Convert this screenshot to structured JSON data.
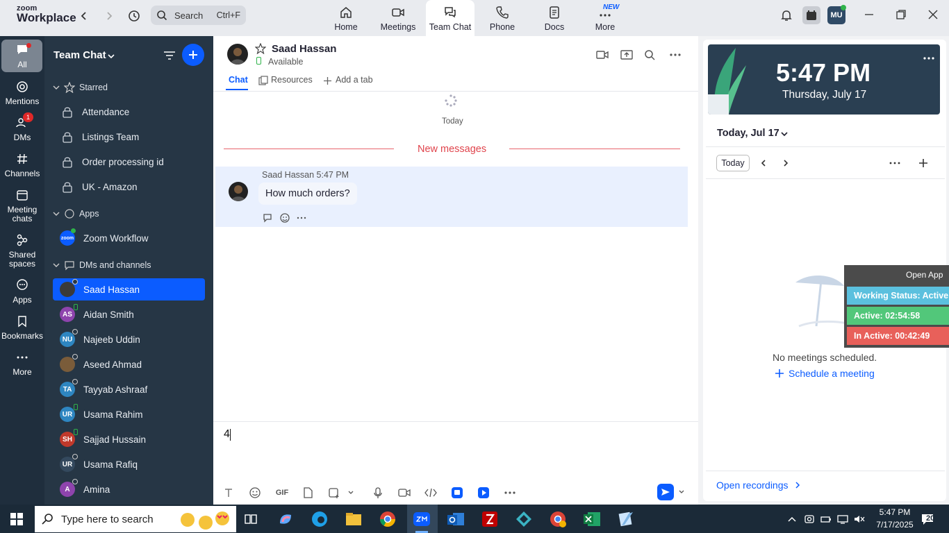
{
  "app": {
    "brand_top": "zoom",
    "brand_bottom": "Workplace"
  },
  "search": {
    "label": "Search",
    "shortcut": "Ctrl+F"
  },
  "nav_tabs": [
    {
      "label": "Home"
    },
    {
      "label": "Meetings"
    },
    {
      "label": "Team Chat",
      "active": true
    },
    {
      "label": "Phone"
    },
    {
      "label": "Docs"
    },
    {
      "label": "More",
      "badge": "NEW"
    }
  ],
  "user_avatar": "MU",
  "rail": [
    {
      "label": "All",
      "active": true
    },
    {
      "label": "Mentions"
    },
    {
      "label": "DMs",
      "badge": "1"
    },
    {
      "label": "Channels"
    },
    {
      "label": "Meeting chats"
    },
    {
      "label": "Shared spaces"
    },
    {
      "label": "Apps"
    },
    {
      "label": "Bookmarks"
    },
    {
      "label": "More"
    }
  ],
  "sidebar": {
    "title": "Team Chat",
    "sections": {
      "starred": "Starred",
      "apps": "Apps",
      "dms": "DMs and channels"
    },
    "starred_items": [
      "Attendance",
      "Listings Team",
      "Order processing id",
      "UK - Amazon"
    ],
    "app_items": [
      {
        "name": "Zoom Workflow",
        "icon_text": "zoom"
      }
    ],
    "dm_items": [
      {
        "name": "Saad Hassan",
        "initials": "",
        "color": "#3a3a3a",
        "selected": true
      },
      {
        "name": "Aidan Smith",
        "initials": "AS",
        "color": "#8e44ad",
        "online": true
      },
      {
        "name": "Najeeb Uddin",
        "initials": "NU",
        "color": "#2e86c1"
      },
      {
        "name": "Aseed Ahmad",
        "initials": "",
        "color": "#7a5c3a"
      },
      {
        "name": "Tayyab Ashraaf",
        "initials": "TA",
        "color": "#2e86c1"
      },
      {
        "name": "Usama Rahim",
        "initials": "UR",
        "color": "#2e86c1",
        "online": true
      },
      {
        "name": "Sajjad Hussain",
        "initials": "SH",
        "color": "#c0392b",
        "online": true
      },
      {
        "name": "Usama Rafiq",
        "initials": "UR",
        "color": "#34495e"
      },
      {
        "name": "Amina",
        "initials": "A",
        "color": "#8e44ad"
      }
    ]
  },
  "chat": {
    "contact_name": "Saad Hassan",
    "contact_status": "Available",
    "tabs": [
      "Chat",
      "Resources",
      "Add a tab"
    ],
    "day_label": "Today",
    "new_messages": "New messages",
    "message": {
      "sender": "Saad Hassan",
      "time": "5:47 PM",
      "text": "How much orders?"
    },
    "composer_value": "4"
  },
  "right_panel": {
    "time": "5:47 PM",
    "date": "Thursday, July 17",
    "agenda_date": "Today, Jul 17",
    "today_btn": "Today",
    "empty_text": "No meetings scheduled.",
    "schedule_link": "Schedule a meeting",
    "recordings_link": "Open recordings"
  },
  "status_overlay": {
    "open_app": "Open App",
    "working": "Working Status: Active",
    "active": "Active: 02:54:58",
    "inactive": "In Active: 00:42:49",
    "colors": {
      "working": "#5bc0de",
      "active": "#52c77a",
      "inactive": "#e8605a"
    }
  },
  "taskbar": {
    "search_placeholder": "Type here to search",
    "clock_time": "5:47 PM",
    "clock_date": "7/17/2025",
    "notif_count": "20"
  }
}
